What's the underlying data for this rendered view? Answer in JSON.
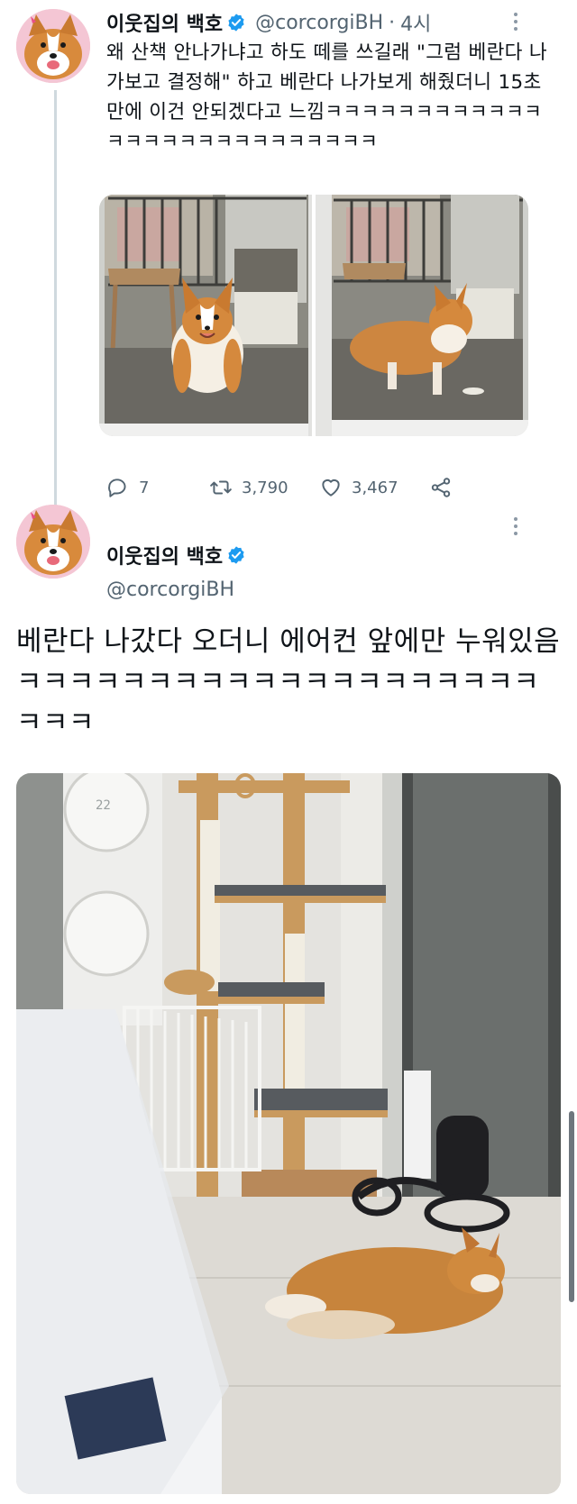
{
  "tweet1": {
    "author_name": "이웃집의 백호",
    "handle": "@corcorgiBH",
    "separator": "·",
    "time": "4시",
    "text": "왜 산책 안나가냐고 하도 떼를 쓰길래 \"그럼 베란다 나가보고 결정해\" 하고 베란다 나가보게 해줬더니 15초만에 이건 안되겠다고 느낌ㅋㅋㅋㅋㅋㅋㅋㅋㅋㅋㅋㅋㅋㅋㅋㅋㅋㅋㅋㅋㅋㅋㅋㅋㅋㅋㅋ",
    "actions": {
      "reply_count": "7",
      "retweet_count": "3,790",
      "like_count": "3,467"
    }
  },
  "tweet2": {
    "author_name": "이웃집의 백호",
    "handle": "@corcorgiBH",
    "text": "베란다 나갔다 오더니 에어컨 앞에만 누워있음ㅋㅋㅋㅋㅋㅋㅋㅋㅋㅋㅋㅋㅋㅋㅋㅋㅋㅋㅋㅋㅋㅋㅋ",
    "photo_text": {
      "ac_display": "22"
    }
  },
  "icons": {
    "reply": "reply-icon",
    "retweet": "retweet-icon",
    "like": "heart-icon",
    "share": "share-icon",
    "verified": "verified-badge-icon",
    "more": "more-icon"
  },
  "colors": {
    "verified_blue": "#1d9bf0",
    "text_primary": "#0f1419",
    "text_secondary": "#536471",
    "thread_line": "#cfd9de"
  }
}
